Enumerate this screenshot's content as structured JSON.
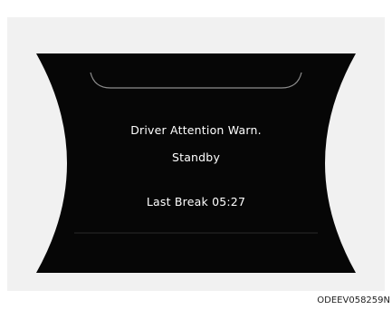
{
  "display": {
    "title": "Driver Attention Warn.",
    "status": "Standby",
    "last_break_label": "Last Break 05:27"
  },
  "caption": "ODEEV058259N",
  "colors": {
    "background": "#f1f1f1",
    "display": "#060606",
    "text": "#ffffff",
    "accent_line": "#8c8c8c"
  }
}
